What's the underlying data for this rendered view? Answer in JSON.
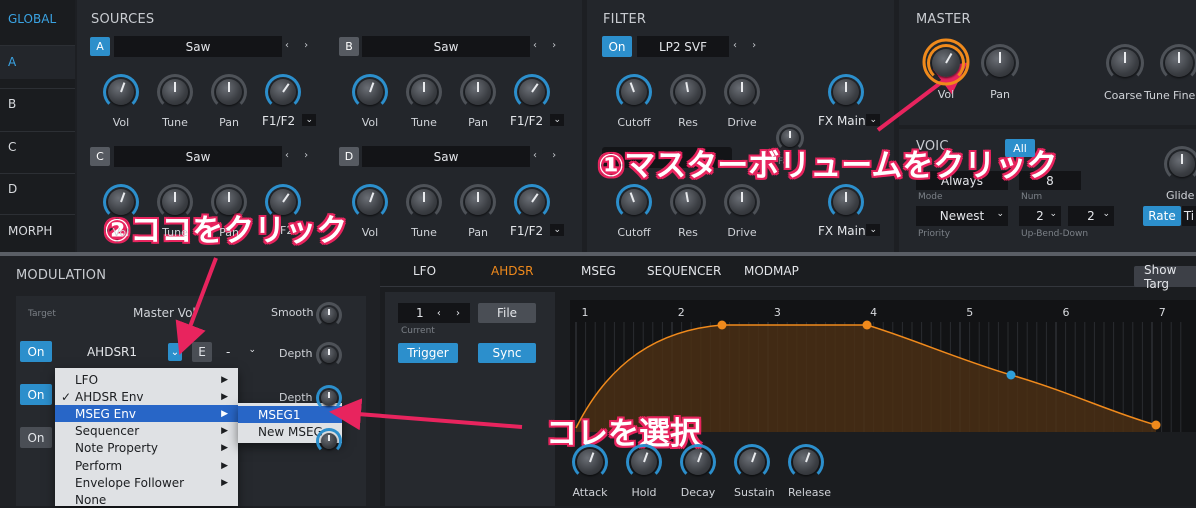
{
  "sidebar": {
    "global": "GLOBAL",
    "items": [
      "A",
      "B",
      "C",
      "D",
      "MORPH"
    ]
  },
  "sources": {
    "title": "SOURCES",
    "slots": [
      {
        "letter": "A",
        "wave": "Saw",
        "knobs": [
          "Vol",
          "Tune",
          "Pan"
        ],
        "route": "F1/F2",
        "active": true
      },
      {
        "letter": "B",
        "wave": "Saw",
        "knobs": [
          "Vol",
          "Tune",
          "Pan"
        ],
        "route": "F1/F2",
        "active": false
      },
      {
        "letter": "C",
        "wave": "Saw",
        "knobs": [
          "Vol",
          "Tune",
          "Pan"
        ],
        "route": "F1/F2",
        "active": false
      },
      {
        "letter": "D",
        "wave": "Saw",
        "knobs": [
          "Vol",
          "Tune",
          "Pan"
        ],
        "route": "F1/F2",
        "active": false
      }
    ]
  },
  "filter": {
    "title": "FILTER",
    "on_label": "On",
    "type": "LP2 SVF",
    "knobs": [
      "Cutoff",
      "Res",
      "Drive"
    ],
    "route": "FX Main",
    "partial_text": "Fa"
  },
  "master": {
    "title": "MASTER",
    "knobs": [
      "Vol",
      "Pan",
      "Coarse",
      "Tune",
      "Fine"
    ]
  },
  "voicing": {
    "title_partial": "VOIC",
    "tab_partial": "All",
    "mode_value": "Always",
    "mode_label": "Mode",
    "num_value": "8",
    "num_label": "Num",
    "priority_value": "Newest",
    "priority_label": "Priority",
    "bend_up": "2",
    "bend_down": "2",
    "bend_label": "Up-Bend-Down",
    "glide_label": "Glide",
    "rate_btn": "Rate",
    "time_btn_partial": "Ti"
  },
  "modulation": {
    "title": "MODULATION",
    "target_label": "Target",
    "target_value": "Master Vol",
    "smooth_label": "Smooth",
    "row1": {
      "on": "On",
      "source": "AHDSR1",
      "e_btn": "E",
      "dash": "-",
      "depth": "Depth"
    },
    "row2": {
      "on": "On",
      "depth": "Depth"
    },
    "row3": {
      "on": "On"
    }
  },
  "context_menu": {
    "items": [
      {
        "label": "LFO",
        "check": "",
        "arrow": "▶"
      },
      {
        "label": "AHDSR Env",
        "check": "✓",
        "arrow": "▶"
      },
      {
        "label": "MSEG Env",
        "check": "",
        "arrow": "▶"
      },
      {
        "label": "Sequencer",
        "check": "",
        "arrow": "▶"
      },
      {
        "label": "Note Property",
        "check": "",
        "arrow": "▶"
      },
      {
        "label": "Perform",
        "check": "",
        "arrow": "▶"
      },
      {
        "label": "Envelope Follower",
        "check": "",
        "arrow": "▶"
      },
      {
        "label": "None",
        "check": "",
        "arrow": ""
      }
    ],
    "selected_index": 2,
    "submenu": [
      "MSEG1",
      "New MSEG"
    ]
  },
  "mod_tabs": [
    "LFO",
    "AHDSR",
    "MSEG",
    "SEQUENCER",
    "MODMAP"
  ],
  "active_tab": "AHDSR",
  "show_target_btn": "Show Targ",
  "envelope": {
    "current_value": "1",
    "current_label": "Current",
    "file_btn": "File",
    "trigger_btn": "Trigger",
    "sync_btn": "Sync",
    "grid_numbers": [
      "1",
      "2",
      "3",
      "4",
      "5",
      "6",
      "7"
    ],
    "knobs": [
      "Attack",
      "Hold",
      "Decay",
      "Sustain",
      "Release"
    ]
  },
  "annotations": {
    "step1": "①マスターボリュームをクリック",
    "step2": "②ココをクリック",
    "step3": "コレを選択"
  },
  "colors": {
    "accent_blue": "#2c8fcc",
    "accent_orange": "#f08a1c",
    "annotation_pink": "#e8245e",
    "background": "#1d1f23"
  }
}
